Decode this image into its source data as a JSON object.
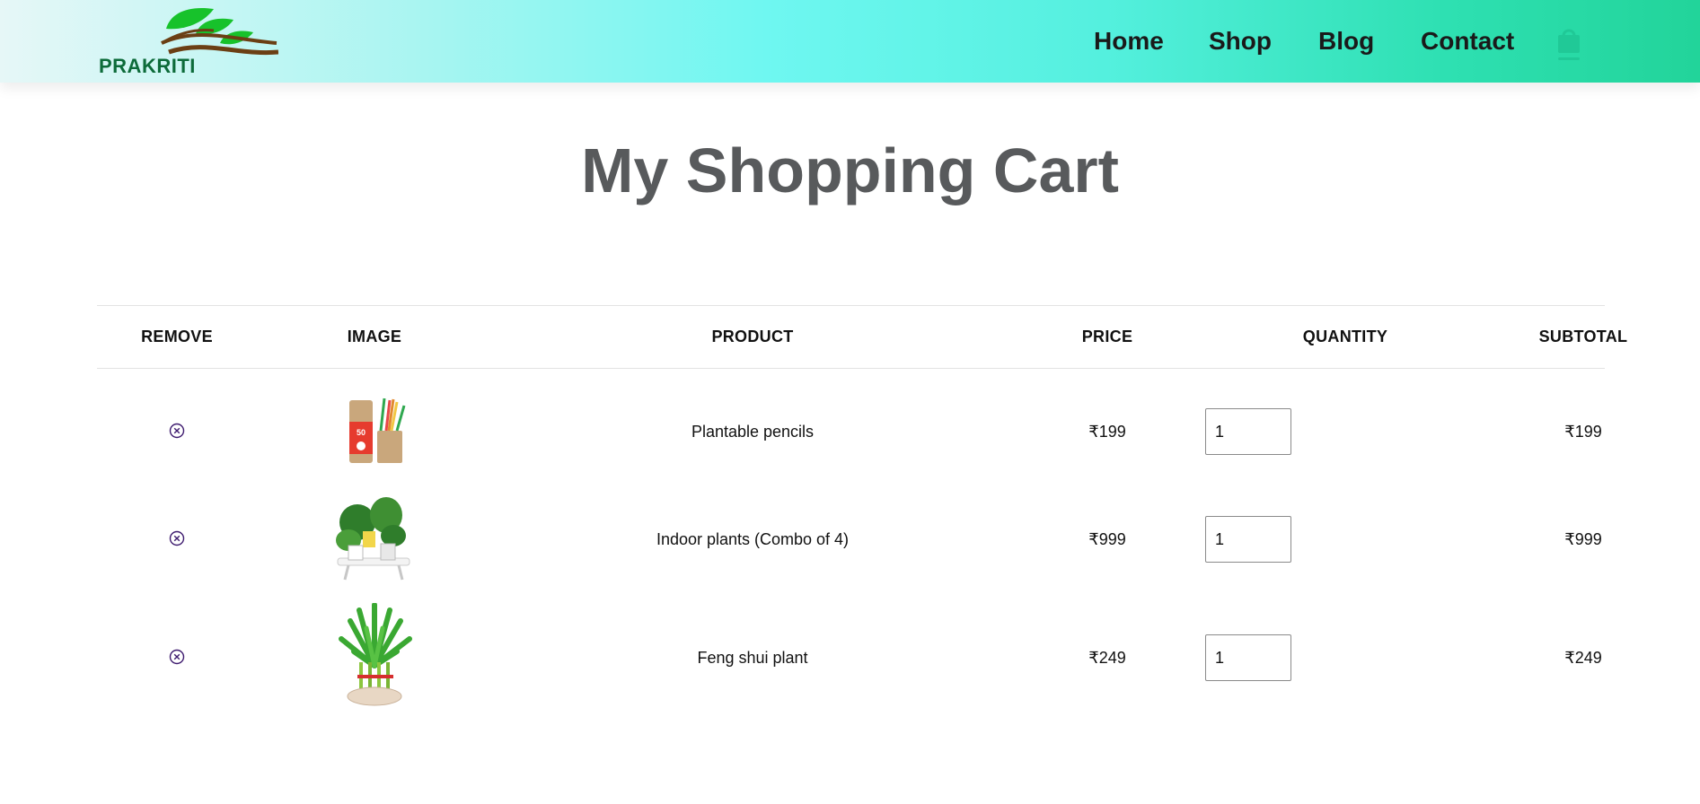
{
  "brand": {
    "name": "PRAKRITI",
    "logo_colors": [
      "#17c22b",
      "#6b3f14",
      "#0d6b3a"
    ]
  },
  "nav": {
    "items": [
      {
        "label": "Home"
      },
      {
        "label": "Shop"
      },
      {
        "label": "Blog"
      },
      {
        "label": "Contact"
      }
    ],
    "cart_icon": "shopping-bag-icon",
    "cart_icon_color": "#20c997"
  },
  "page": {
    "title": "My Shopping Cart"
  },
  "table": {
    "columns": [
      "REMOVE",
      "IMAGE",
      "PRODUCT",
      "PRICE",
      "QUANTITY",
      "SUBTOTAL"
    ],
    "rows": [
      {
        "product": "Plantable pencils",
        "price": "₹199",
        "quantity": "1",
        "subtotal": "₹199",
        "image": "plantable-pencils"
      },
      {
        "product": "Indoor plants (Combo of 4)",
        "price": "₹999",
        "quantity": "1",
        "subtotal": "₹999",
        "image": "indoor-plants-combo"
      },
      {
        "product": "Feng shui plant",
        "price": "₹249",
        "quantity": "1",
        "subtotal": "₹249",
        "image": "feng-shui-plant"
      }
    ],
    "remove_icon": "close-circle-icon",
    "remove_icon_color": "#3d1a6e"
  }
}
